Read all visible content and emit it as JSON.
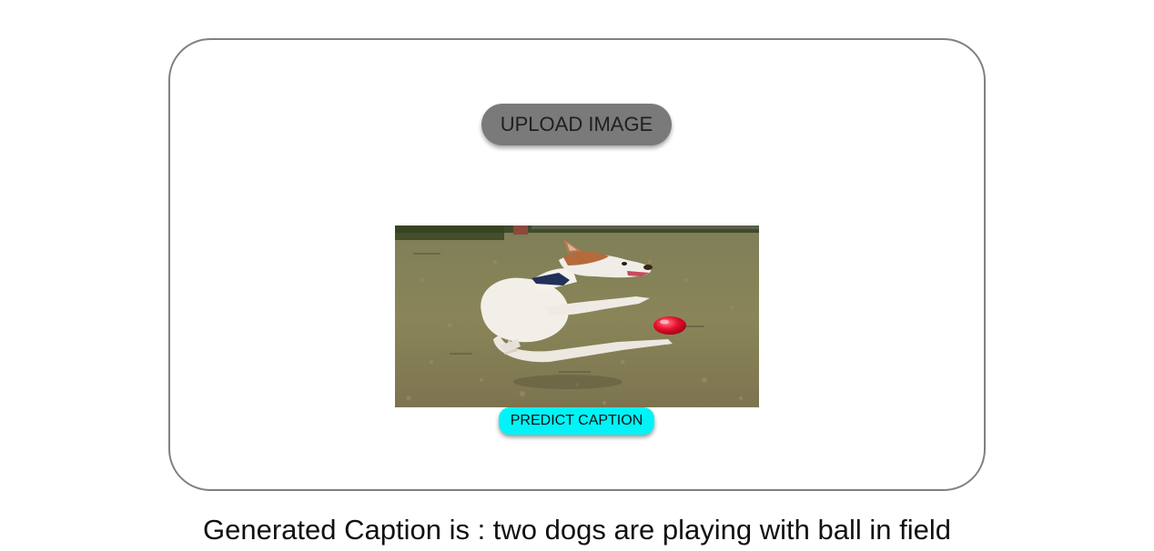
{
  "upload": {
    "label": "UPLOAD IMAGE"
  },
  "image": {
    "subject": "dog-jumping-for-ball-photo"
  },
  "predict": {
    "label": "PREDICT CAPTION"
  },
  "result": {
    "caption_text": "Generated Caption is : two dogs are playing with ball in field"
  },
  "colors": {
    "upload_button_bg": "#7a7a7a",
    "predict_button_bg": "#00f4f7",
    "card_border": "#808080"
  }
}
